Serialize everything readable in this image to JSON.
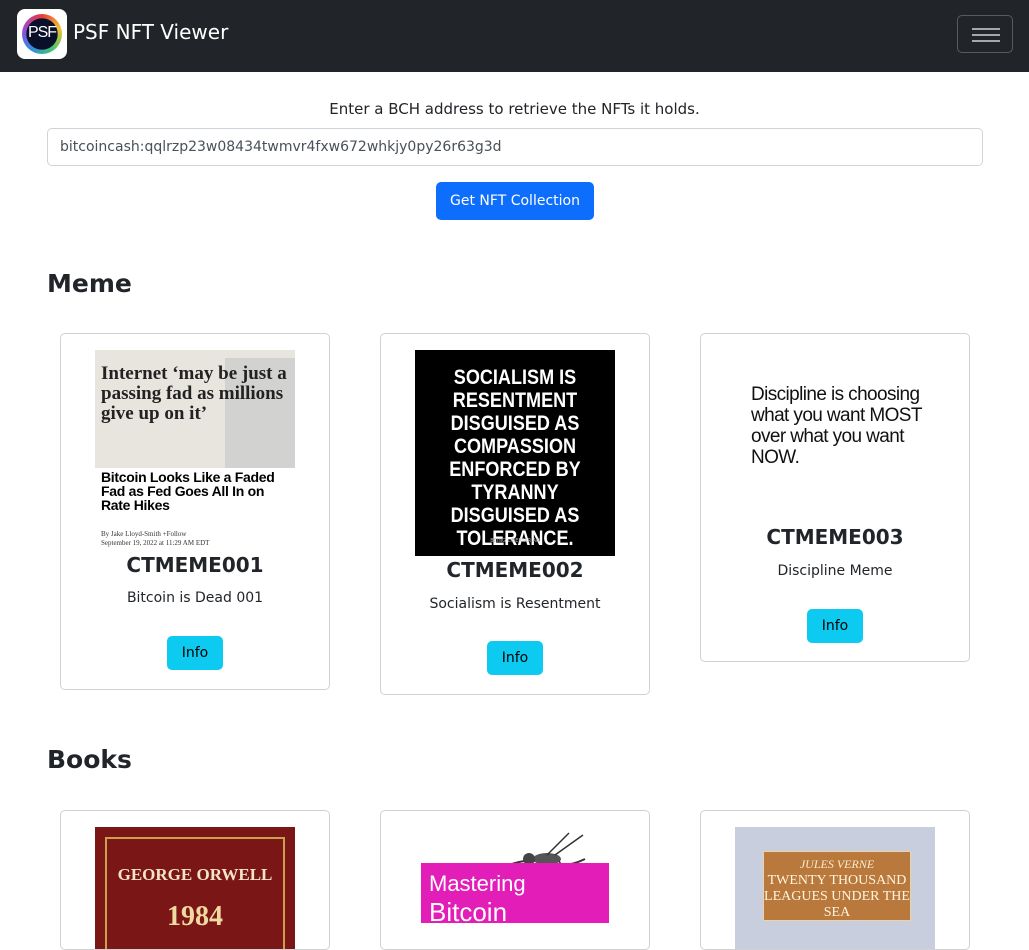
{
  "navbar": {
    "logo_text": "PSF",
    "brand_name": "PSF NFT Viewer",
    "toggler_icon": "hamburger-icon"
  },
  "search": {
    "intro": "Enter a BCH address to retrieve the NFTs it holds.",
    "address_value": "bitcoincash:qqlrzp23w08434twmvr4fxw672whkjy0py26r63g3d",
    "button_label": "Get NFT Collection"
  },
  "sections": {
    "meme": {
      "title": "Meme",
      "cards": [
        {
          "name": "CTMEME001",
          "description": "Bitcoin is Dead 001",
          "info_label": "Info",
          "image": {
            "headline": "Internet ‘may be just a passing fad as millions give up on it’",
            "subheadline": "Bitcoin Looks Like a Faded Fad as Fed Goes All In on Rate Hikes",
            "byline": "By Jake Lloyd-Smith +Follow",
            "dateline": "September 19, 2022 at 11:29 AM EDT"
          }
        },
        {
          "name": "CTMEME002",
          "description": "Socialism is Resentment",
          "info_label": "Info",
          "image": {
            "text": "SOCIALISM IS RESENTMENT DISGUISED AS COMPASSION ENFORCED BY TYRANNY DISGUISED AS TOLERANCE.",
            "credit": "BEING LIBERTARIAN"
          }
        },
        {
          "name": "CTMEME003",
          "description": "Discipline Meme",
          "info_label": "Info",
          "image": {
            "text": "Discipline is choosing what you want MOST over what you want NOW."
          }
        }
      ]
    },
    "books": {
      "title": "Books",
      "cards": [
        {
          "image": {
            "author": "GEORGE ORWELL",
            "title_partial": "1984"
          }
        },
        {
          "image": {
            "title_top": "Mastering",
            "title_partial": "Bitcoin"
          }
        },
        {
          "image": {
            "author": "JULES VERNE",
            "title": "TWENTY THOUSAND LEAGUES UNDER THE SEA"
          }
        }
      ]
    }
  }
}
